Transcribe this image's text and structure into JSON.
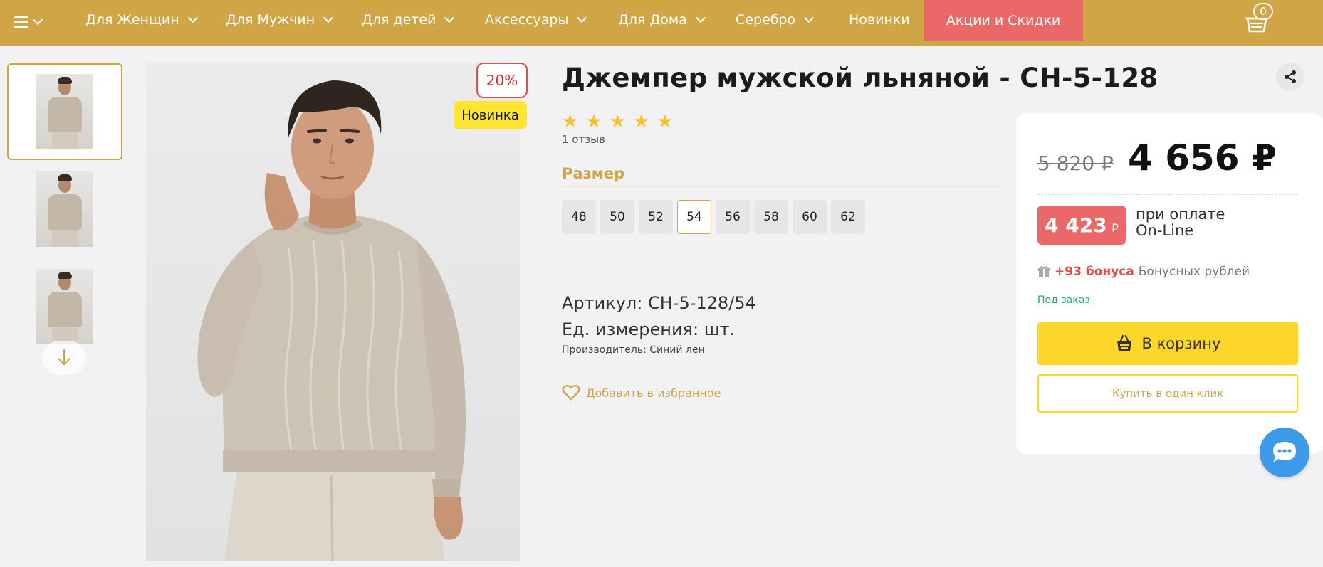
{
  "nav": {
    "items": [
      {
        "label": "Для Женщин"
      },
      {
        "label": "Для Мужчин"
      },
      {
        "label": "Для детей"
      },
      {
        "label": "Аксессуары"
      },
      {
        "label": "Для Дома"
      },
      {
        "label": "Серебро"
      },
      {
        "label": "Новинки"
      }
    ],
    "sale_label": "Акции и Скидки",
    "cart_count": "0",
    "colors": {
      "bar": "#cfa546",
      "sale": "#ec6767"
    }
  },
  "gallery": {
    "thumbnail_count": 3,
    "discount_badge": "20%",
    "new_badge": "Новинка"
  },
  "product": {
    "title": "Джемпер мужской льняной - СН-5-128",
    "rating": 5,
    "reviews": "1 отзыв",
    "size_title": "Размер",
    "sizes": [
      "48",
      "50",
      "52",
      "54",
      "56",
      "58",
      "60",
      "62"
    ],
    "selected_size": "54",
    "article_label": "Артикул:",
    "article_value": "СН-5-128/54",
    "unit_label": "Ед. измерения:",
    "unit_value": "шт.",
    "maker": "Производитель: Синий лен",
    "favorite_label": "Добавить в избранное"
  },
  "price": {
    "old": "5 820 ₽",
    "current": "4 656 ₽",
    "online_price": "4 423",
    "online_currency": "₽",
    "online_text_1": "при оплате",
    "online_text_2": "On-Line",
    "bonus_amount": "+93 бонуса",
    "bonus_text": "Бонусных рублей",
    "availability": "Под заказ",
    "add_to_cart": "В корзину",
    "one_click": "Купить в один клик",
    "colors": {
      "accent": "#ffd629",
      "sale": "#ec6767",
      "stock": "#1fb26a"
    }
  }
}
